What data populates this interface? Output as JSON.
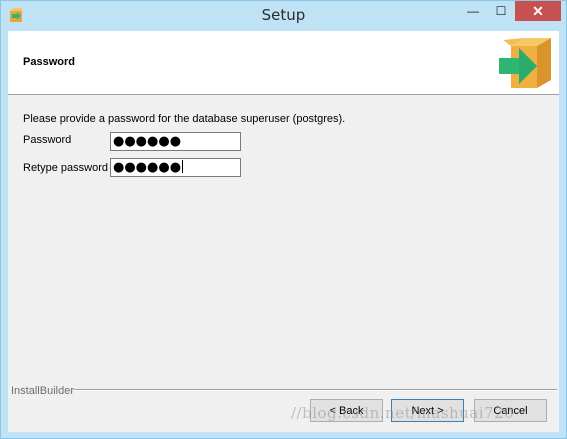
{
  "window": {
    "title": "Setup",
    "minimize_glyph": "—",
    "maximize_glyph": "☐",
    "close_glyph": "✕"
  },
  "header": {
    "title": "Password",
    "logo_icon": "installer-box-arrow-icon"
  },
  "body": {
    "intro": "Please provide a password for the database superuser (postgres).",
    "password_label": "Password",
    "password_value": "●●●●●●",
    "retype_label": "Retype password",
    "retype_value": "●●●●●●"
  },
  "footer": {
    "brand": "InstallBuilder",
    "back_label": "< Back",
    "next_label": "Next >",
    "cancel_label": "Cancel"
  },
  "watermark": "//blog.csdn.net/mashuai720",
  "colors": {
    "titlebar": "#bfe3f5",
    "close_button": "#c75050",
    "panel": "#f0f0f0",
    "box_orange": "#f0b041",
    "arrow_green": "#2fb673"
  }
}
